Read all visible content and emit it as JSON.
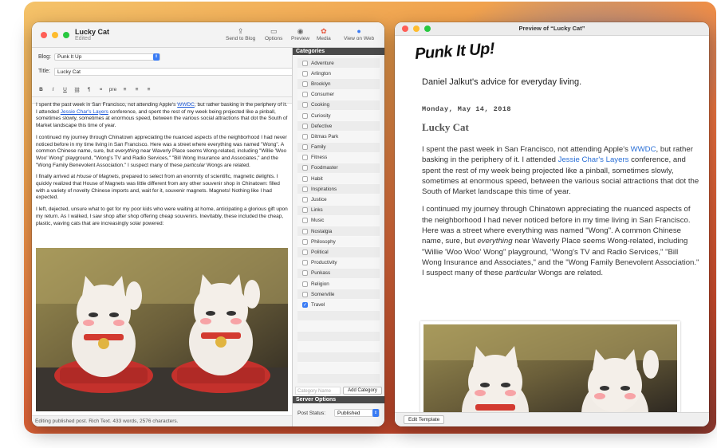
{
  "editor": {
    "doc_title": "Lucky Cat",
    "doc_subtitle": "Edited",
    "toolbar": [
      {
        "label": "Send to Blog",
        "icon": "share-icon"
      },
      {
        "label": "Options",
        "icon": "sidebar-icon"
      },
      {
        "label": "Preview",
        "icon": "eye-icon"
      },
      {
        "label": "Media",
        "icon": "photos-icon"
      },
      {
        "label": "View on Web",
        "icon": "globe-icon"
      }
    ],
    "blog_label": "Blog:",
    "blog_value": "Punk It Up",
    "title_label": "Title:",
    "title_value": "Lucky Cat",
    "format_buttons": [
      "B",
      "I",
      "U",
      "🔗",
      "¶",
      "❝",
      "pre",
      "≡",
      "≡",
      "≡"
    ],
    "paragraphs": {
      "p1_a": "I spent the past week in San Francisco, not attending Apple's ",
      "p1_link1": "WWDC",
      "p1_b": ", but rather basking in the periphery of it. I attended ",
      "p1_link2": "Jessie Char's Layers",
      "p1_c": " conference, and spent the rest of my week being projected like a pinball, sometimes slowly, sometimes at enormous speed, between the various social attractions that dot the South of Market landscape this time of year.",
      "p2_a": "I continued my journey through Chinatown appreciating the nuanced aspects of the neighborhood I had never noticed before in my time living in San Francisco. Here was a street where everything was named \"Wong\". A common Chinese name, sure, but ",
      "p2_em": "everything",
      "p2_b": " near Waverly Place seems Wong-related, including \"Willie 'Woo Woo' Wong\" playground, \"Wong's TV and Radio Services,\" \"Bill Wong Insurance and Associates,\" and the \"Wong Family Benevolent Association.\" I suspect many of these ",
      "p2_em2": "particular",
      "p2_c": " Wongs are related.",
      "p3_a": "I finally arrived at ",
      "p3_em": "House of Magnets",
      "p3_b": ", prepared to select from an enormity of scientific, magnetic delights. I quickly realized that House of Magnets was little different from any other souvenir shop in Chinatown: filled with a variety of novelty Chinese imports and, wait for it, souvenir magnets. Magnets! Nothing like I had expected.",
      "p4": "I left, dejected, unsure what to get for my poor kids who were waiting at home, anticipating a glorious gift upon my return. As I walked, I saw shop after shop offering cheap souvenirs. Inevitably, these included the cheap, plastic, waving cats that are increasingly solar powered:"
    },
    "status_bar": "Editing published post. Rich Text. 433 words, 2576 characters."
  },
  "categories": {
    "header": "Categories",
    "items": [
      {
        "name": "Adventure",
        "checked": false
      },
      {
        "name": "Arlington",
        "checked": false
      },
      {
        "name": "Brooklyn",
        "checked": false
      },
      {
        "name": "Consumer",
        "checked": false
      },
      {
        "name": "Cooking",
        "checked": false
      },
      {
        "name": "Curiosity",
        "checked": false
      },
      {
        "name": "Defective",
        "checked": false
      },
      {
        "name": "Ditmas Park",
        "checked": false
      },
      {
        "name": "Family",
        "checked": false
      },
      {
        "name": "Fitness",
        "checked": false
      },
      {
        "name": "Foodmaster",
        "checked": false
      },
      {
        "name": "Habit",
        "checked": false
      },
      {
        "name": "Inspirations",
        "checked": false
      },
      {
        "name": "Justice",
        "checked": false
      },
      {
        "name": "Links",
        "checked": false
      },
      {
        "name": "Music",
        "checked": false
      },
      {
        "name": "Nostalgia",
        "checked": false
      },
      {
        "name": "Philosophy",
        "checked": false
      },
      {
        "name": "Political",
        "checked": false
      },
      {
        "name": "Productivity",
        "checked": false
      },
      {
        "name": "Punkass",
        "checked": false
      },
      {
        "name": "Religion",
        "checked": false
      },
      {
        "name": "Somerville",
        "checked": false
      },
      {
        "name": "Travel",
        "checked": true
      }
    ],
    "name_placeholder": "Category Name",
    "add_button": "Add Category",
    "server_header": "Server Options",
    "post_status_label": "Post Status:",
    "post_status_value": "Published"
  },
  "preview": {
    "window_title": "Preview of “Lucky Cat”",
    "blog_name": "Punk It Up!",
    "tagline": "Daniel Jalkut's advice for everyday living.",
    "date": "Monday, May 14, 2018",
    "post_title": "Lucky Cat",
    "p1_a": "I spent the past week in San Francisco, not attending Apple's ",
    "p1_link1": "WWDC",
    "p1_b": ", but rather basking in the periphery of it. I attended ",
    "p1_link2": "Jessie Char's Layers",
    "p1_c": " conference, and spent the rest of my week being projected like a pinball, sometimes slowly, sometimes at enormous speed, between the various social attractions that dot the South of Market landscape this time of year.",
    "p2_a": "I continued my journey through Chinatown appreciating the nuanced aspects of the neighborhood I had never noticed before in my time living in San Francisco. Here was a street where everything was named \"Wong\". A common Chinese name, sure, but ",
    "p2_em": "everything",
    "p2_b": " near Waverly Place seems Wong-related, including \"Willie 'Woo Woo' Wong\" playground, \"Wong's TV and Radio Services,\" \"Bill Wong Insurance and Associates,\" and the \"Wong Family Benevolent Association.\" I suspect many of these ",
    "p2_em2": "particular",
    "p2_c": " Wongs are related.",
    "edit_template": "Edit Template"
  },
  "colors": {
    "accent": "#3a7cf5",
    "link": "#1a56d6",
    "panel_header": "#4a4a4a"
  }
}
